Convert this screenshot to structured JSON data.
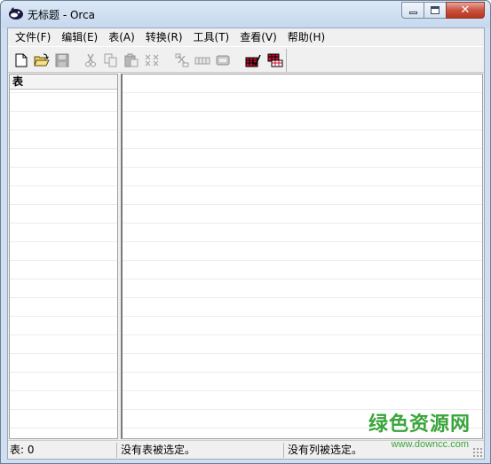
{
  "window": {
    "title": "无标题 - Orca",
    "icon": "orca-app-icon"
  },
  "caption_buttons": {
    "minimize_icon": "minimize-icon",
    "maximize_icon": "maximize-icon",
    "close_glyph": "✕"
  },
  "menu": [
    {
      "label": "文件(F)"
    },
    {
      "label": "编辑(E)"
    },
    {
      "label": "表(A)"
    },
    {
      "label": "转换(R)"
    },
    {
      "label": "工具(T)"
    },
    {
      "label": "查看(V)"
    },
    {
      "label": "帮助(H)"
    }
  ],
  "toolbar": {
    "buttons": [
      {
        "icon": "new-document-icon",
        "enabled": true
      },
      {
        "icon": "open-folder-icon",
        "enabled": true
      },
      {
        "icon": "save-disk-icon",
        "enabled": false
      },
      {
        "icon": "cut-icon",
        "enabled": false
      },
      {
        "icon": "copy-icon",
        "enabled": false
      },
      {
        "icon": "paste-icon",
        "enabled": false
      },
      {
        "icon": "paste-special-icon",
        "enabled": false
      },
      {
        "icon": "table-cut-icon",
        "enabled": false
      },
      {
        "icon": "add-row-icon",
        "enabled": false
      },
      {
        "icon": "table-edit-icon",
        "enabled": false
      },
      {
        "icon": "validate-icon",
        "enabled": true
      },
      {
        "icon": "merge-module-icon",
        "enabled": true
      }
    ]
  },
  "left_pane": {
    "header": "表"
  },
  "status": {
    "tables": "表: 0",
    "table_selection": "没有表被选定。",
    "column_selection": "没有列被选定。"
  },
  "watermark": {
    "text": "绿色资源网",
    "url": "www.downcc.com"
  },
  "colors": {
    "accent_green": "#3aa53a",
    "validate_red": "#c8102e",
    "close_red": "#c9533f"
  }
}
